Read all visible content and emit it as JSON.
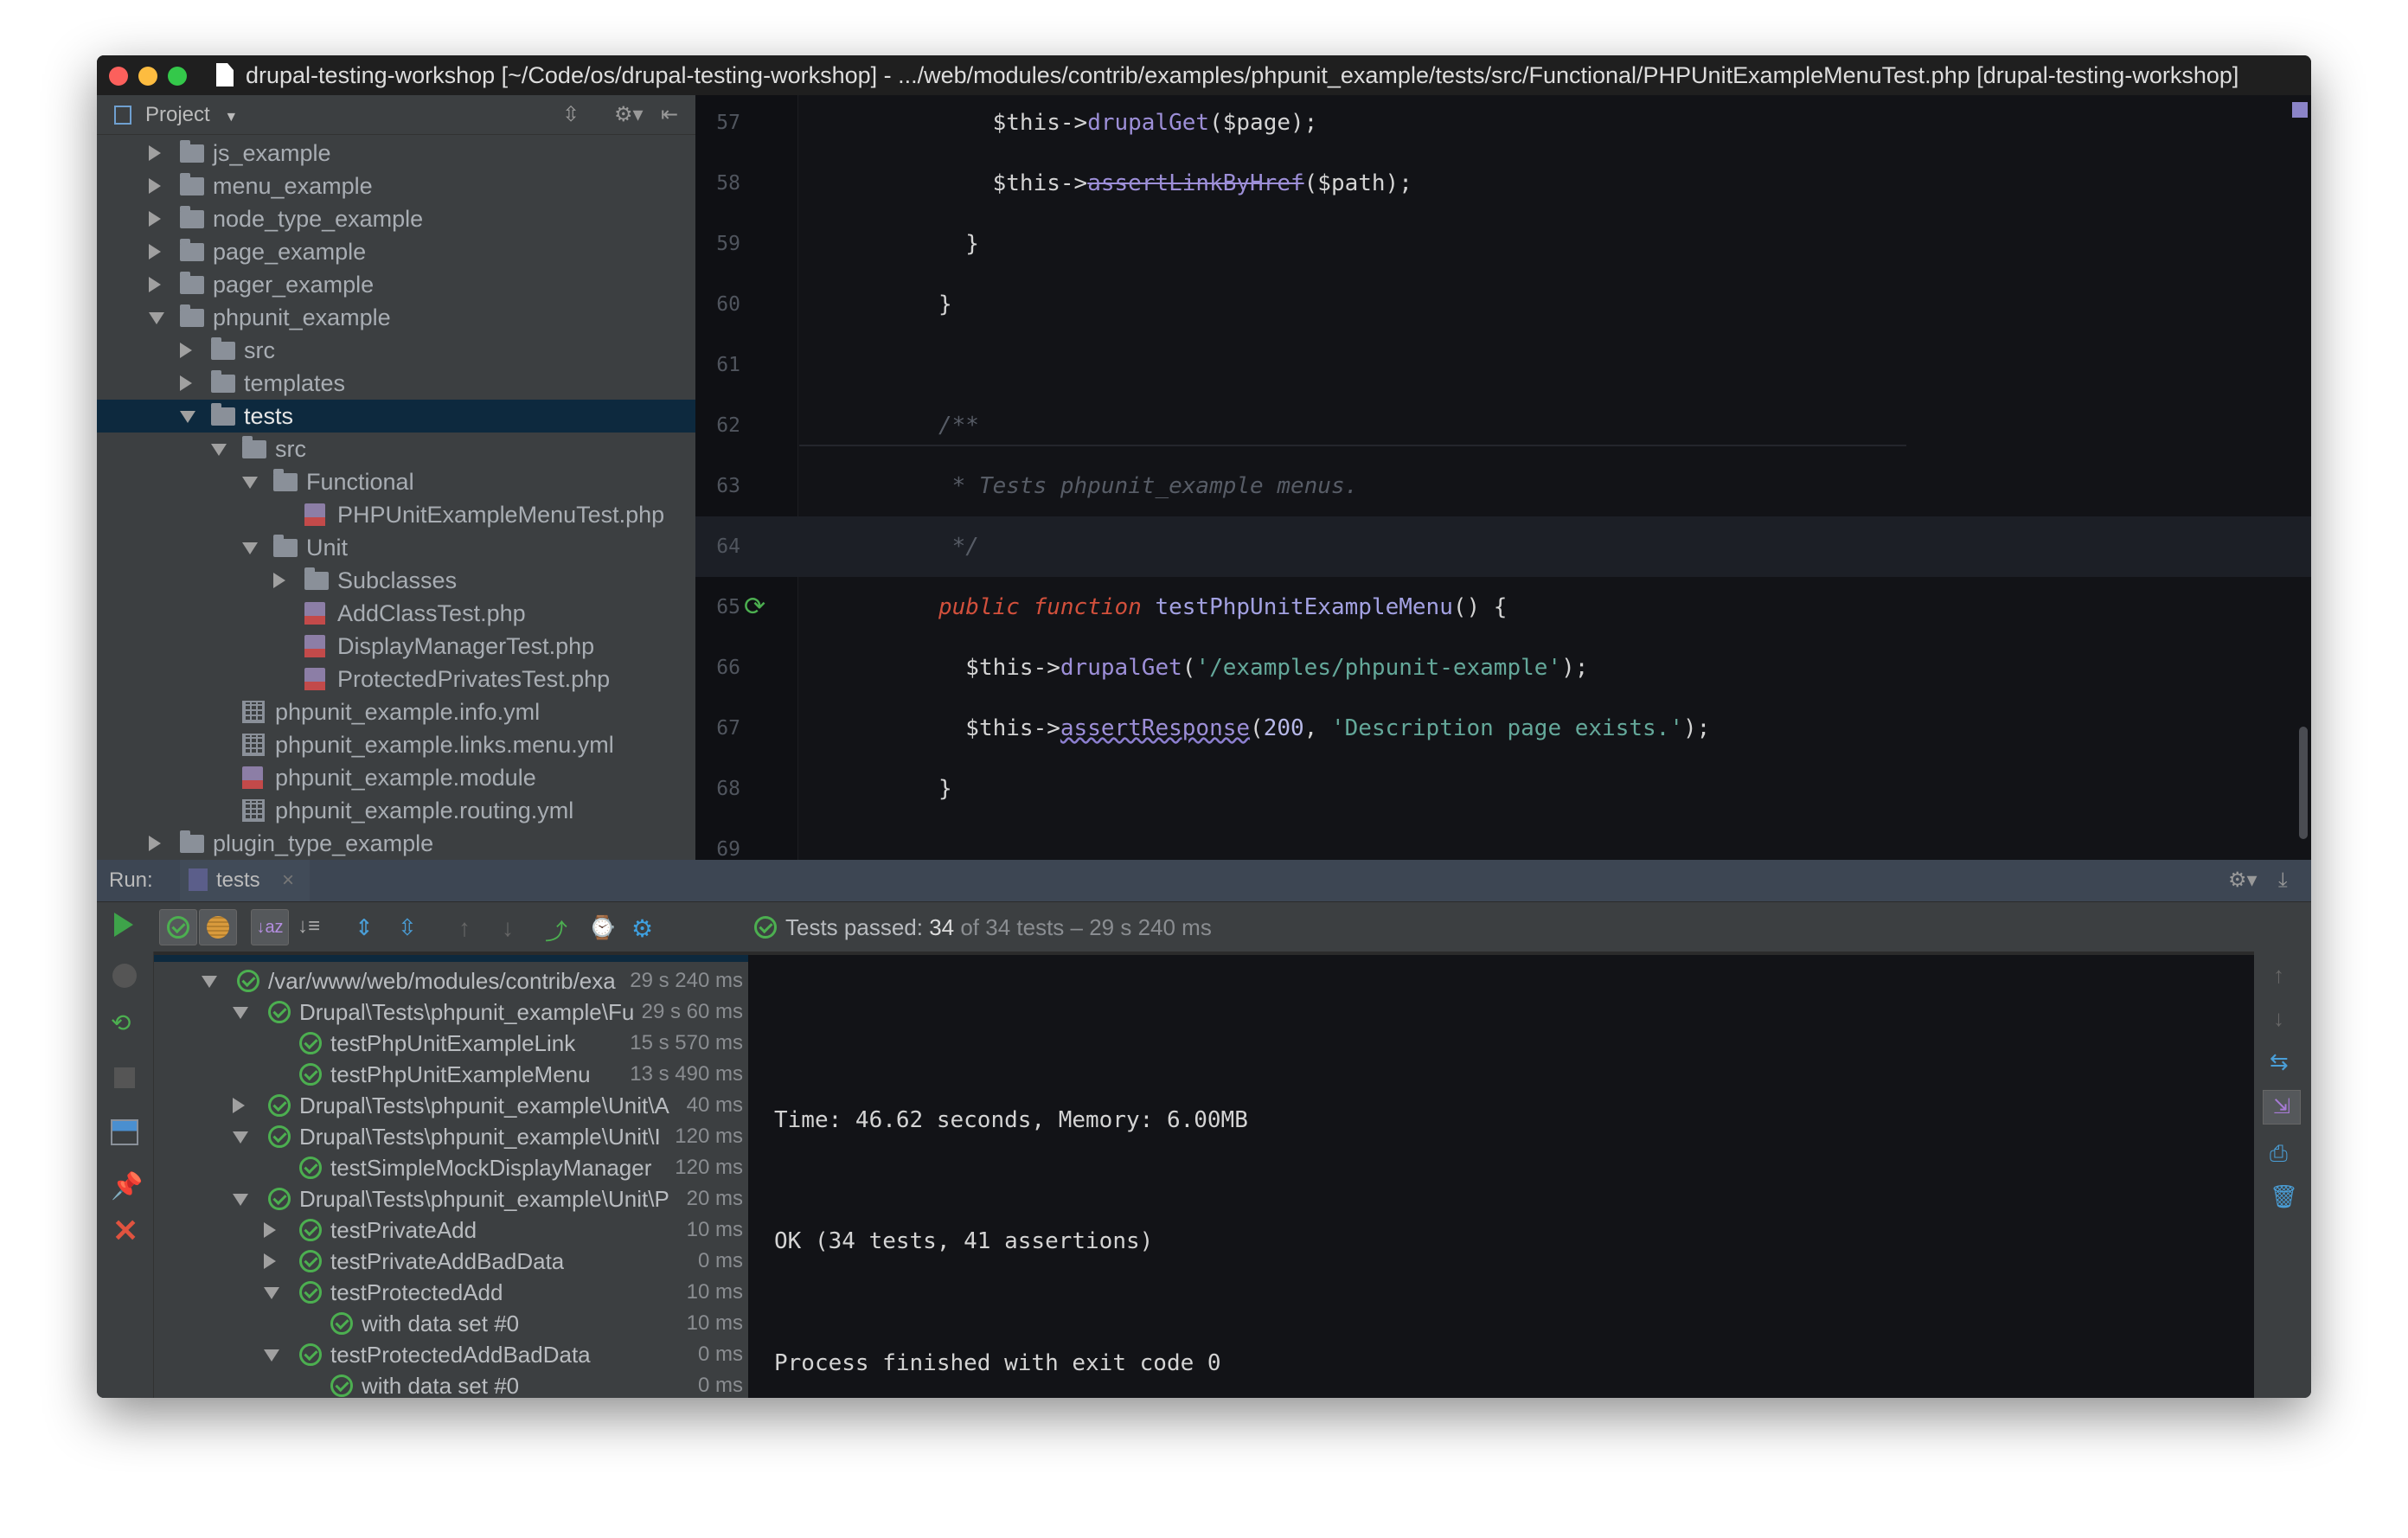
{
  "window": {
    "title": "drupal-testing-workshop [~/Code/os/drupal-testing-workshop] - .../web/modules/contrib/examples/phpunit_example/tests/src/Functional/PHPUnitExampleMenuTest.php [drupal-testing-workshop]",
    "traffic_lights": [
      "#fc605c",
      "#fdbc40",
      "#34c84a"
    ]
  },
  "project_panel": {
    "title": "Project",
    "items": [
      {
        "label": "js_example",
        "depth": 0,
        "arrow": "right",
        "icon": "folder"
      },
      {
        "label": "menu_example",
        "depth": 0,
        "arrow": "right",
        "icon": "folder"
      },
      {
        "label": "node_type_example",
        "depth": 0,
        "arrow": "right",
        "icon": "folder"
      },
      {
        "label": "page_example",
        "depth": 0,
        "arrow": "right",
        "icon": "folder"
      },
      {
        "label": "pager_example",
        "depth": 0,
        "arrow": "right",
        "icon": "folder"
      },
      {
        "label": "phpunit_example",
        "depth": 0,
        "arrow": "down",
        "icon": "folder"
      },
      {
        "label": "src",
        "depth": 1,
        "arrow": "right",
        "icon": "folder"
      },
      {
        "label": "templates",
        "depth": 1,
        "arrow": "right",
        "icon": "folder"
      },
      {
        "label": "tests",
        "depth": 1,
        "arrow": "down",
        "icon": "folder",
        "selected": true
      },
      {
        "label": "src",
        "depth": 2,
        "arrow": "down",
        "icon": "folder"
      },
      {
        "label": "Functional",
        "depth": 3,
        "arrow": "down",
        "icon": "folder"
      },
      {
        "label": "PHPUnitExampleMenuTest.php",
        "depth": 4,
        "arrow": "",
        "icon": "php"
      },
      {
        "label": "Unit",
        "depth": 3,
        "arrow": "down",
        "icon": "folder"
      },
      {
        "label": "Subclasses",
        "depth": 4,
        "arrow": "right",
        "icon": "folder"
      },
      {
        "label": "AddClassTest.php",
        "depth": 4,
        "arrow": "",
        "icon": "php"
      },
      {
        "label": "DisplayManagerTest.php",
        "depth": 4,
        "arrow": "",
        "icon": "php"
      },
      {
        "label": "ProtectedPrivatesTest.php",
        "depth": 4,
        "arrow": "",
        "icon": "php"
      },
      {
        "label": "phpunit_example.info.yml",
        "depth": 2,
        "arrow": "",
        "icon": "yml"
      },
      {
        "label": "phpunit_example.links.menu.yml",
        "depth": 2,
        "arrow": "",
        "icon": "yml"
      },
      {
        "label": "phpunit_example.module",
        "depth": 2,
        "arrow": "",
        "icon": "php"
      },
      {
        "label": "phpunit_example.routing.yml",
        "depth": 2,
        "arrow": "",
        "icon": "yml"
      },
      {
        "label": "plugin_type_example",
        "depth": 0,
        "arrow": "right",
        "icon": "folder"
      }
    ]
  },
  "editor": {
    "lines": [
      {
        "n": "57",
        "tokens": [
          {
            "t": "    $this->",
            "c": "plain"
          },
          {
            "t": "drupalGet",
            "c": "call"
          },
          {
            "t": "($page);",
            "c": "plain"
          }
        ]
      },
      {
        "n": "58",
        "tokens": [
          {
            "t": "    $this->",
            "c": "plain"
          },
          {
            "t": "assertLinkByHref",
            "c": "strike"
          },
          {
            "t": "($path);",
            "c": "plain"
          }
        ]
      },
      {
        "n": "59",
        "tokens": [
          {
            "t": "  }",
            "c": "plain"
          }
        ]
      },
      {
        "n": "60",
        "tokens": [
          {
            "t": "}",
            "c": "plain"
          }
        ]
      },
      {
        "n": "61",
        "tokens": []
      },
      {
        "n": "62",
        "tokens": [
          {
            "t": "/**",
            "c": "cmt"
          }
        ]
      },
      {
        "n": "63",
        "tokens": [
          {
            "t": " * Tests phpunit_example menus.",
            "c": "cmt"
          }
        ]
      },
      {
        "n": "64",
        "tokens": [
          {
            "t": " */",
            "c": "cmt"
          }
        ],
        "current": true
      },
      {
        "n": "65",
        "tokens": [
          {
            "t": "public",
            "c": "kw"
          },
          {
            "t": " ",
            "c": "plain"
          },
          {
            "t": "function",
            "c": "kw"
          },
          {
            "t": " ",
            "c": "plain"
          },
          {
            "t": "testPhpUnitExampleMenu",
            "c": "fn"
          },
          {
            "t": "() {",
            "c": "plain"
          }
        ],
        "run_icon": true
      },
      {
        "n": "66",
        "tokens": [
          {
            "t": "  $this->",
            "c": "plain"
          },
          {
            "t": "drupalGet",
            "c": "call"
          },
          {
            "t": "(",
            "c": "plain"
          },
          {
            "t": "'/examples/phpunit-example'",
            "c": "str"
          },
          {
            "t": ");",
            "c": "plain"
          }
        ]
      },
      {
        "n": "67",
        "tokens": [
          {
            "t": "  $this->",
            "c": "plain"
          },
          {
            "t": "assertResponse",
            "c": "wavy"
          },
          {
            "t": "(",
            "c": "plain"
          },
          {
            "t": "200",
            "c": "num"
          },
          {
            "t": ", ",
            "c": "plain"
          },
          {
            "t": "'Description page exists.'",
            "c": "str"
          },
          {
            "t": ");",
            "c": "plain"
          }
        ]
      },
      {
        "n": "68",
        "tokens": [
          {
            "t": "}",
            "c": "plain"
          }
        ]
      },
      {
        "n": "69",
        "tokens": []
      }
    ]
  },
  "run": {
    "label": "Run:",
    "tab": "tests",
    "status_prefix": "Tests passed: ",
    "passed": "34",
    "status_rest": " of 34 tests – 29 s 240 ms",
    "tests": [
      {
        "name": "/var/www/web/modules/contrib/exa",
        "time": "29 s 240 ms",
        "depth": 0,
        "arrow": "down"
      },
      {
        "name": "Drupal\\Tests\\phpunit_example\\Fu",
        "time": "29 s 60 ms",
        "depth": 1,
        "arrow": "down"
      },
      {
        "name": "testPhpUnitExampleLink",
        "time": "15 s 570 ms",
        "depth": 2,
        "arrow": ""
      },
      {
        "name": "testPhpUnitExampleMenu",
        "time": "13 s 490 ms",
        "depth": 2,
        "arrow": ""
      },
      {
        "name": "Drupal\\Tests\\phpunit_example\\Unit\\A",
        "time": "40 ms",
        "depth": 1,
        "arrow": "right"
      },
      {
        "name": "Drupal\\Tests\\phpunit_example\\Unit\\I",
        "time": "120 ms",
        "depth": 1,
        "arrow": "down"
      },
      {
        "name": "testSimpleMockDisplayManager",
        "time": "120 ms",
        "depth": 2,
        "arrow": ""
      },
      {
        "name": "Drupal\\Tests\\phpunit_example\\Unit\\P",
        "time": "20 ms",
        "depth": 1,
        "arrow": "down"
      },
      {
        "name": "testPrivateAdd",
        "time": "10 ms",
        "depth": 2,
        "arrow": "right"
      },
      {
        "name": "testPrivateAddBadData",
        "time": "0 ms",
        "depth": 2,
        "arrow": "right"
      },
      {
        "name": "testProtectedAdd",
        "time": "10 ms",
        "depth": 2,
        "arrow": "down"
      },
      {
        "name": "with data set #0",
        "time": "10 ms",
        "depth": 3,
        "arrow": ""
      },
      {
        "name": "testProtectedAddBadData",
        "time": "0 ms",
        "depth": 2,
        "arrow": "down"
      },
      {
        "name": "with data set #0",
        "time": "0 ms",
        "depth": 3,
        "arrow": ""
      }
    ],
    "console": [
      "Time: 46.62 seconds, Memory: 6.00MB",
      "OK (34 tests, 41 assertions)",
      "Process finished with exit code 0"
    ]
  },
  "colors": {
    "pass": "#4caf50",
    "keyword": "#d2503c",
    "string": "#64a89a",
    "selection": "#0d293e"
  }
}
